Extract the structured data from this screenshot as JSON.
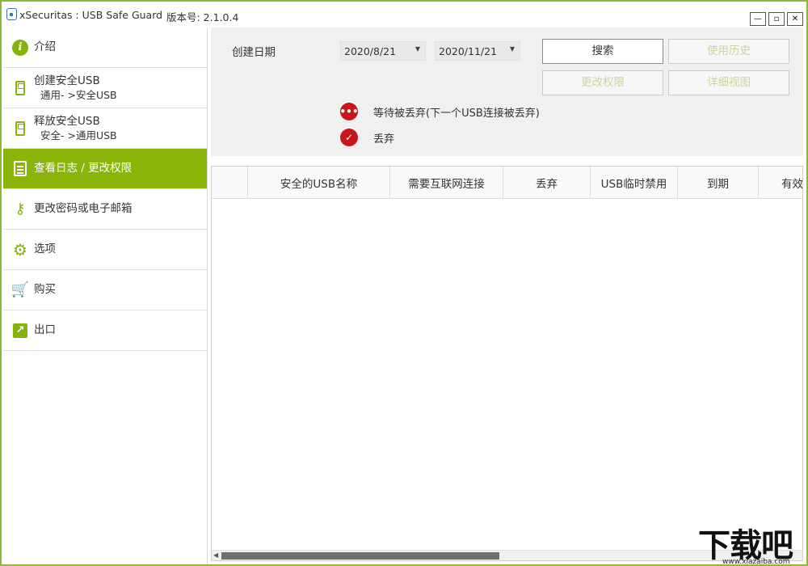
{
  "window": {
    "title": "xSecuritas : USB Safe Guard",
    "version": "版本号: 2.1.0.4",
    "min_glyph": "—",
    "max_glyph": "▫",
    "close_glyph": "✕"
  },
  "sidebar": {
    "items": [
      {
        "label": "介绍",
        "sub": "",
        "icon": "info-icon"
      },
      {
        "label": "创建安全USB",
        "sub": "通用- >安全USB",
        "icon": "usb-icon"
      },
      {
        "label": "释放安全USB",
        "sub": "安全- >通用USB",
        "icon": "usb-icon"
      },
      {
        "label": "查看日志 / 更改权限",
        "sub": "",
        "icon": "log-icon",
        "active": true
      },
      {
        "label": "更改密码或电子邮箱",
        "sub": "",
        "icon": "key-icon"
      },
      {
        "label": "选项",
        "sub": "",
        "icon": "gear-icon"
      },
      {
        "label": "购买",
        "sub": "",
        "icon": "cart-icon"
      },
      {
        "label": "出口",
        "sub": "",
        "icon": "exit-icon"
      }
    ]
  },
  "filter": {
    "date_label": "创建日期",
    "date_from": "2020/8/21",
    "date_to": "2020/11/21",
    "caret": "▼",
    "search_button": "搜索",
    "history_button": "使用历史",
    "change_perm_button": "更改权限",
    "detail_button": "详细视图",
    "legend_pending": "等待被丢弃(下一个USB连接被丢弃)",
    "legend_discarded": "丢弃",
    "pending_glyph": "•••",
    "discarded_glyph": "✓"
  },
  "table": {
    "columns": [
      "",
      "安全的USB名称",
      "需要互联网连接",
      "丢弃",
      "USB临时禁用",
      "到期",
      "有效"
    ],
    "scroll_left": "◀"
  },
  "watermark": {
    "main": "下载吧",
    "url": "www.xiazaiba.com"
  },
  "colors": {
    "accent": "#8cb50c",
    "legend_red": "#c4161c",
    "frame": "#8cb83a"
  }
}
